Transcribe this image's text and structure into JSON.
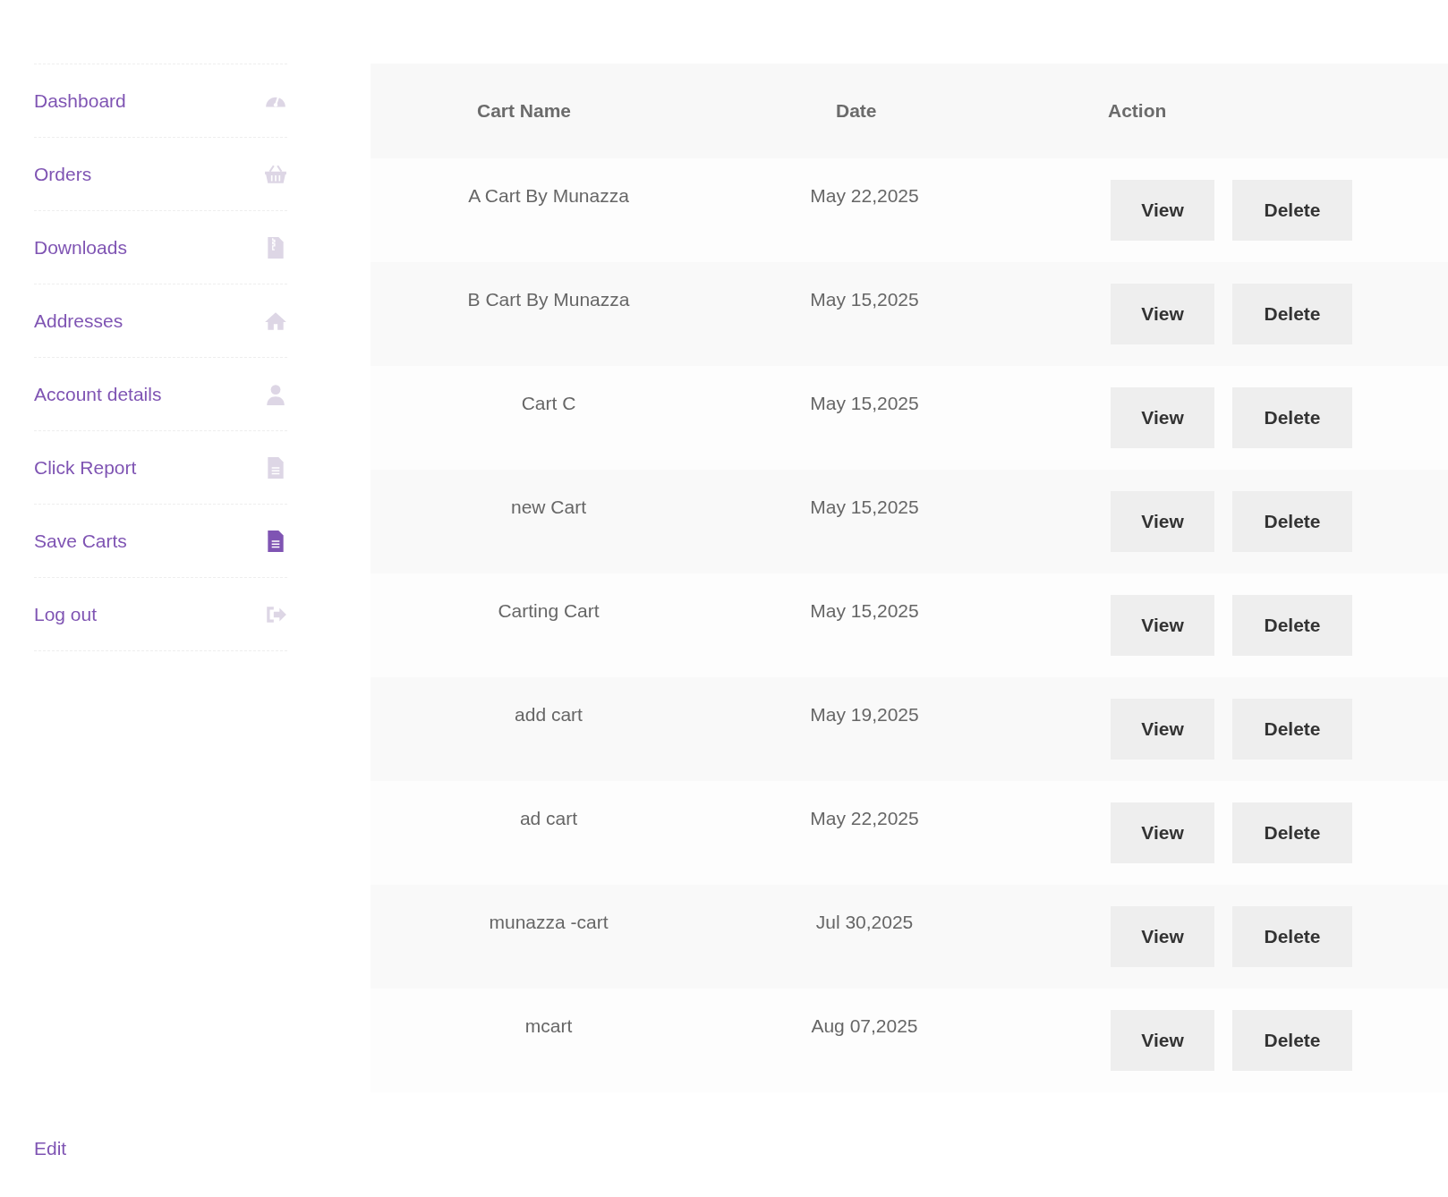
{
  "sidebar": {
    "items": [
      {
        "label": "Dashboard",
        "kind": "gauge",
        "selected": false
      },
      {
        "label": "Orders",
        "kind": "basket",
        "selected": false
      },
      {
        "label": "Downloads",
        "kind": "zipfile",
        "selected": false
      },
      {
        "label": "Addresses",
        "kind": "house",
        "selected": false
      },
      {
        "label": "Account details",
        "kind": "person",
        "selected": false
      },
      {
        "label": "Click Report",
        "kind": "document",
        "selected": false
      },
      {
        "label": "Save Carts",
        "kind": "document",
        "selected": true
      },
      {
        "label": "Log out",
        "kind": "exit",
        "selected": false
      }
    ],
    "edit_link": "Edit"
  },
  "table": {
    "columns": [
      "Cart Name",
      "Date",
      "Action"
    ],
    "rows": [
      {
        "name": "A Cart By Munazza",
        "date": "May 22,2025",
        "actions": [
          "View",
          "Delete"
        ]
      },
      {
        "name": "B Cart By Munazza",
        "date": "May 15,2025",
        "actions": [
          "View",
          "Delete"
        ]
      },
      {
        "name": "Cart C",
        "date": "May 15,2025",
        "actions": [
          "View",
          "Delete"
        ]
      },
      {
        "name": "new Cart",
        "date": "May 15,2025",
        "actions": [
          "View",
          "Delete"
        ]
      },
      {
        "name": "Carting Cart",
        "date": "May 15,2025",
        "actions": [
          "View",
          "Delete"
        ]
      },
      {
        "name": "add cart",
        "date": "May 19,2025",
        "actions": [
          "View",
          "Delete"
        ]
      },
      {
        "name": "ad cart",
        "date": "May 22,2025",
        "actions": [
          "View",
          "Delete"
        ]
      },
      {
        "name": "munazza -cart",
        "date": "Jul 30,2025",
        "actions": [
          "View",
          "Delete"
        ]
      },
      {
        "name": "mcart",
        "date": "Aug 07,2025",
        "actions": [
          "View",
          "Delete"
        ]
      }
    ]
  }
}
